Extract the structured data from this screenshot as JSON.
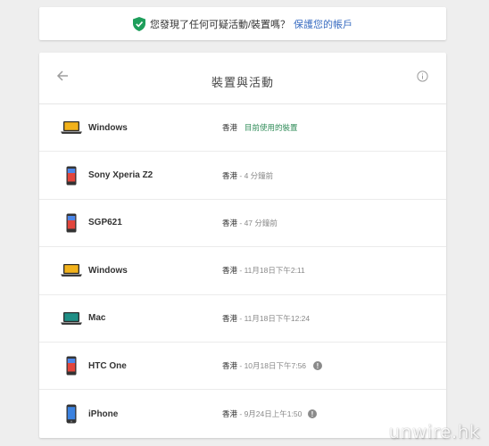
{
  "banner": {
    "text": "您發現了任何可疑活動/裝置嗎？",
    "link": "保護您的帳戶",
    "icon": "shield-check-icon",
    "accent": "#1e9e5b"
  },
  "card": {
    "title": "裝置與活動",
    "back_icon": "arrow-left-icon",
    "info_icon": "info-icon"
  },
  "devices": [
    {
      "name": "Windows",
      "type": "laptop",
      "location": "香港",
      "time": "",
      "current": "目前使用的裝置",
      "alert": false
    },
    {
      "name": "Sony Xperia Z2",
      "type": "phone",
      "location": "香港",
      "time": " - 4 分鐘前",
      "current": "",
      "alert": false
    },
    {
      "name": "SGP621",
      "type": "phone",
      "location": "香港",
      "time": " - 47 分鐘前",
      "current": "",
      "alert": false
    },
    {
      "name": "Windows",
      "type": "laptop",
      "location": "香港",
      "time": " - 11月18日下午2:11",
      "current": "",
      "alert": false
    },
    {
      "name": "Mac",
      "type": "mac",
      "location": "香港",
      "time": " - 11月18日下午12:24",
      "current": "",
      "alert": false
    },
    {
      "name": "HTC One",
      "type": "phone",
      "location": "香港",
      "time": " - 10月18日下午7:56",
      "current": "",
      "alert": true
    },
    {
      "name": "iPhone",
      "type": "iphone",
      "location": "香港",
      "time": " - 9月24日上午1:50",
      "current": "",
      "alert": true
    }
  ],
  "alert_glyph": "!",
  "watermark": "unwire.hk",
  "colors": {
    "link": "#3b6ec2",
    "current": "#2e8b57",
    "laptop_screen": "#f2b21b"
  }
}
